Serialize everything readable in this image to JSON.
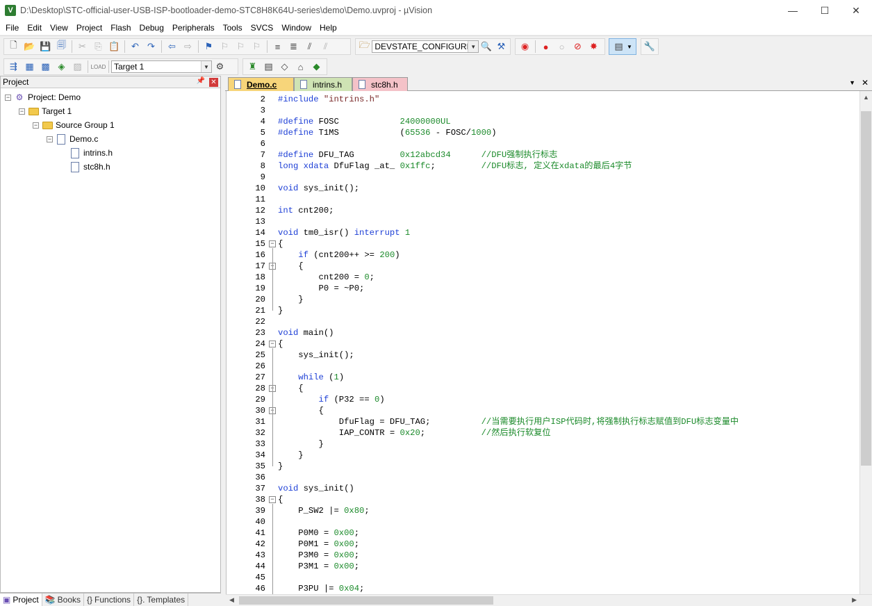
{
  "window": {
    "title": "D:\\Desktop\\STC-official-user-USB-ISP-bootloader-demo-STC8H8K64U-series\\demo\\Demo.uvproj - µVision",
    "icon_letter": "V",
    "controls": {
      "minimize": "—",
      "maximize": "☐",
      "close": "✕"
    }
  },
  "menu": [
    "File",
    "Edit",
    "View",
    "Project",
    "Flash",
    "Debug",
    "Peripherals",
    "Tools",
    "SVCS",
    "Window",
    "Help"
  ],
  "toolbar": {
    "find_combo_value": "DEVSTATE_CONFIGURED",
    "target_combo_value": "Target 1"
  },
  "project_panel": {
    "title": "Project",
    "tree": [
      {
        "label": "Project: Demo",
        "level": 0
      },
      {
        "label": "Target 1",
        "level": 1
      },
      {
        "label": "Source Group 1",
        "level": 2
      },
      {
        "label": "Demo.c",
        "level": 3
      },
      {
        "label": "intrins.h",
        "level": 4
      },
      {
        "label": "stc8h.h",
        "level": 4
      }
    ],
    "bottom_tabs": [
      "Project",
      "Books",
      "Functions",
      "Templates"
    ]
  },
  "editor": {
    "tabs": [
      {
        "label": "Demo.c",
        "active": true,
        "color": "#f7d57a"
      },
      {
        "label": "intrins.h",
        "active": false,
        "color": "#cfe3b4"
      },
      {
        "label": "stc8h.h",
        "active": false,
        "color": "#f4c2c8"
      }
    ],
    "lines": [
      {
        "n": "2",
        "t": "#include \"intrins.h\""
      },
      {
        "n": "3",
        "t": ""
      },
      {
        "n": "4",
        "t": "#define FOSC            24000000UL"
      },
      {
        "n": "5",
        "t": "#define T1MS            (65536 - FOSC/1000)"
      },
      {
        "n": "6",
        "t": ""
      },
      {
        "n": "7",
        "t": "#define DFU_TAG         0x12abcd34      //DFU强制执行标志"
      },
      {
        "n": "8",
        "t": "long xdata DfuFlag _at_ 0x1ffc;         //DFU标志, 定义在xdata的最后4字节"
      },
      {
        "n": "9",
        "t": ""
      },
      {
        "n": "10",
        "t": "void sys_init();"
      },
      {
        "n": "11",
        "t": ""
      },
      {
        "n": "12",
        "t": "int cnt200;"
      },
      {
        "n": "13",
        "t": ""
      },
      {
        "n": "14",
        "t": "void tm0_isr() interrupt 1"
      },
      {
        "n": "15",
        "t": "{"
      },
      {
        "n": "16",
        "t": "    if (cnt200++ >= 200)"
      },
      {
        "n": "17",
        "t": "    {"
      },
      {
        "n": "18",
        "t": "        cnt200 = 0;"
      },
      {
        "n": "19",
        "t": "        P0 = ~P0;"
      },
      {
        "n": "20",
        "t": "    }"
      },
      {
        "n": "21",
        "t": "}"
      },
      {
        "n": "22",
        "t": ""
      },
      {
        "n": "23",
        "t": "void main()"
      },
      {
        "n": "24",
        "t": "{"
      },
      {
        "n": "25",
        "t": "    sys_init();"
      },
      {
        "n": "26",
        "t": ""
      },
      {
        "n": "27",
        "t": "    while (1)"
      },
      {
        "n": "28",
        "t": "    {"
      },
      {
        "n": "29",
        "t": "        if (P32 == 0)"
      },
      {
        "n": "30",
        "t": "        {"
      },
      {
        "n": "31",
        "t": "            DfuFlag = DFU_TAG;          //当需要执行用户ISP代码时,将强制执行标志赋值到DFU标志变量中"
      },
      {
        "n": "32",
        "t": "            IAP_CONTR = 0x20;           //然后执行软复位"
      },
      {
        "n": "33",
        "t": "        }"
      },
      {
        "n": "34",
        "t": "    }"
      },
      {
        "n": "35",
        "t": "}"
      },
      {
        "n": "36",
        "t": ""
      },
      {
        "n": "37",
        "t": "void sys_init()"
      },
      {
        "n": "38",
        "t": "{"
      },
      {
        "n": "39",
        "t": "    P_SW2 |= 0x80;"
      },
      {
        "n": "40",
        "t": ""
      },
      {
        "n": "41",
        "t": "    P0M0 = 0x00;"
      },
      {
        "n": "42",
        "t": "    P0M1 = 0x00;"
      },
      {
        "n": "43",
        "t": "    P3M0 = 0x00;"
      },
      {
        "n": "44",
        "t": "    P3M1 = 0x00;"
      },
      {
        "n": "45",
        "t": ""
      },
      {
        "n": "46",
        "t": "    P3PU |= 0x04;"
      }
    ],
    "fold_lines": [
      "15",
      "17",
      "24",
      "28",
      "30",
      "38"
    ]
  }
}
